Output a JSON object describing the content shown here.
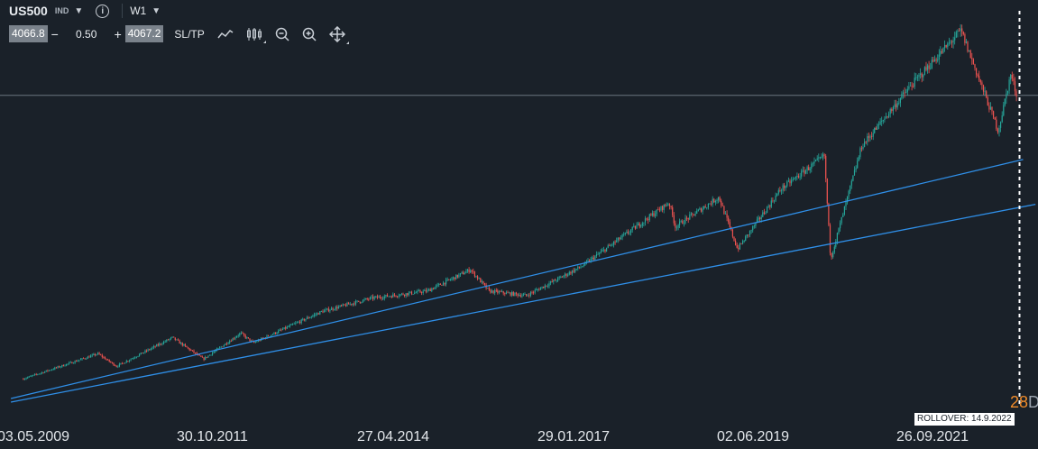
{
  "header": {
    "symbol": "US500",
    "instrument_type": "IND",
    "timeframe": "W1"
  },
  "trade_panel": {
    "bid": "4066.8",
    "minus": "−",
    "quantity": "0.50",
    "plus": "+",
    "ask": "4067.2",
    "sltp_label": "SL/TP"
  },
  "toolbar_icons": [
    "line-chart-icon",
    "candlestick-icon",
    "zoom-out-icon",
    "zoom-in-icon",
    "move-icon"
  ],
  "rollover_label": "ROLLOVER: 14.9.2022",
  "right_badge": {
    "number": "28",
    "suffix": "D"
  },
  "colors": {
    "background": "#1a2129",
    "bull": "#26a69a",
    "bear": "#ef5350",
    "trendline": "#2f8fe8",
    "badge": "#f08c2a"
  },
  "chart_data": {
    "type": "candlestick",
    "symbol": "US500",
    "timeframe": "W1",
    "x_tick_labels": [
      "03.05.2009",
      "30.10.2011",
      "27.04.2014",
      "29.01.2017",
      "02.06.2019",
      "26.09.2021"
    ],
    "price_anchors": [
      {
        "date": "2009-05",
        "price": 900
      },
      {
        "date": "2010-05",
        "price": 1180
      },
      {
        "date": "2010-08",
        "price": 1040
      },
      {
        "date": "2011-05",
        "price": 1360
      },
      {
        "date": "2011-10",
        "price": 1120
      },
      {
        "date": "2012-04",
        "price": 1410
      },
      {
        "date": "2012-06",
        "price": 1300
      },
      {
        "date": "2013-05",
        "price": 1650
      },
      {
        "date": "2014-01",
        "price": 1800
      },
      {
        "date": "2014-10",
        "price": 1880
      },
      {
        "date": "2015-05",
        "price": 2120
      },
      {
        "date": "2015-08",
        "price": 1880
      },
      {
        "date": "2016-02",
        "price": 1830
      },
      {
        "date": "2016-11",
        "price": 2160
      },
      {
        "date": "2018-01",
        "price": 2870
      },
      {
        "date": "2018-02",
        "price": 2600
      },
      {
        "date": "2018-09",
        "price": 2930
      },
      {
        "date": "2018-12",
        "price": 2350
      },
      {
        "date": "2019-07",
        "price": 3020
      },
      {
        "date": "2020-02",
        "price": 3390
      },
      {
        "date": "2020-03",
        "price": 2240
      },
      {
        "date": "2020-08",
        "price": 3500
      },
      {
        "date": "2021-04",
        "price": 4180
      },
      {
        "date": "2021-12",
        "price": 4790
      },
      {
        "date": "2022-06",
        "price": 3670
      },
      {
        "date": "2022-08",
        "price": 4300
      },
      {
        "date": "2022-09",
        "price": 4067
      }
    ],
    "current_price": 4067,
    "trendlines": [
      {
        "from": {
          "date": "2009-03",
          "price": 680
        },
        "to": {
          "date": "2022-10",
          "price": 3350
        }
      },
      {
        "from": {
          "date": "2009-03",
          "price": 640
        },
        "to": {
          "date": "2022-12",
          "price": 2850
        }
      }
    ],
    "rollover_date": "2022-09-14",
    "grid": false
  }
}
